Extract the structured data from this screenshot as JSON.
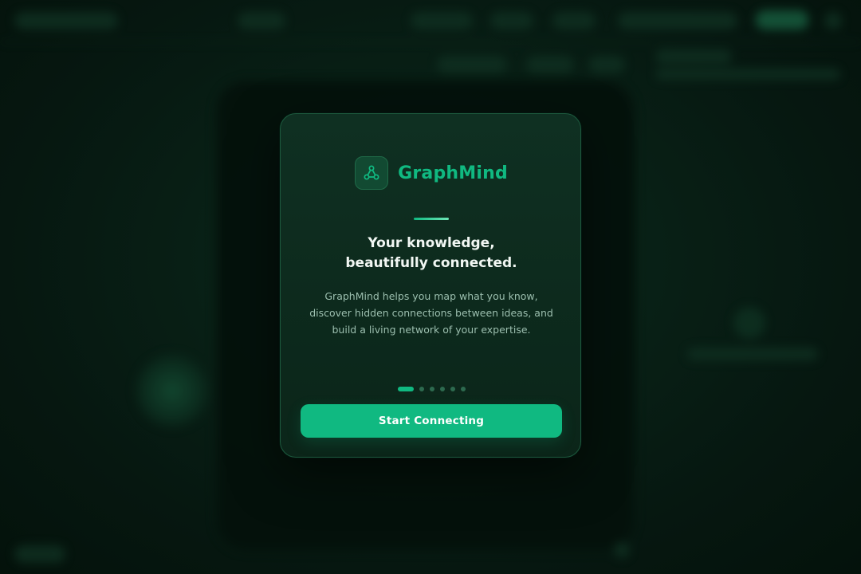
{
  "brand": {
    "name": "GraphMind",
    "logo_icon": "network-graph-icon",
    "accent_color": "#10b981"
  },
  "onboarding": {
    "headline_line1": "Your knowledge,",
    "headline_line2": "beautifully connected.",
    "description": "GraphMind helps you map what you know, discover hidden connections between ideas, and build a living network of your expertise.",
    "total_steps": 6,
    "current_step": 1,
    "cta_label": "Start Connecting"
  }
}
